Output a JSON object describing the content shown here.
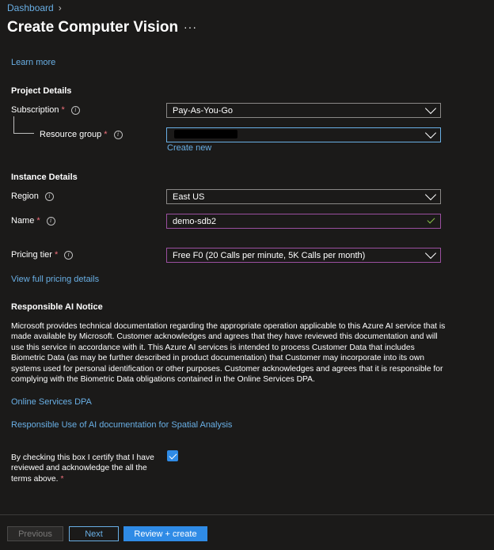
{
  "breadcrumb": {
    "root": "Dashboard"
  },
  "header": {
    "title": "Create Computer Vision",
    "more": "···"
  },
  "learn_more": "Learn more",
  "project": {
    "heading": "Project Details",
    "subscription_label": "Subscription",
    "subscription_value": "Pay-As-You-Go",
    "resource_group_label": "Resource group",
    "resource_group_value": "",
    "create_new": "Create new"
  },
  "instance": {
    "heading": "Instance Details",
    "region_label": "Region",
    "region_value": "East US",
    "name_label": "Name",
    "name_value": "demo-sdb2",
    "pricing_label": "Pricing tier",
    "pricing_value": "Free F0 (20 Calls per minute, 5K Calls per month)",
    "pricing_link": "View full pricing details"
  },
  "notice": {
    "heading": "Responsible AI Notice",
    "body": "Microsoft provides technical documentation regarding the appropriate operation applicable to this Azure AI service that is made available by Microsoft. Customer acknowledges and agrees that they have reviewed this documentation and will use this service in accordance with it. This Azure AI services is intended to process Customer Data that includes Biometric Data (as may be further described in product documentation) that Customer may incorporate into its own systems used for personal identification or other purposes. Customer acknowledges and agrees that it is responsible for complying with the Biometric Data obligations contained in the Online Services DPA.",
    "link_dpa": "Online Services DPA",
    "link_spatial": "Responsible Use of AI documentation for Spatial Analysis",
    "certify": "By checking this box I certify that I have reviewed and acknowledge the all the terms above.",
    "certify_checked": true
  },
  "footer": {
    "previous": "Previous",
    "next": "Next",
    "review": "Review + create"
  },
  "colors": {
    "accent": "#2f8be6",
    "link": "#69afe5",
    "required": "#f1707b",
    "valid_border": "#9b4fa0",
    "background": "#1b1a19"
  }
}
